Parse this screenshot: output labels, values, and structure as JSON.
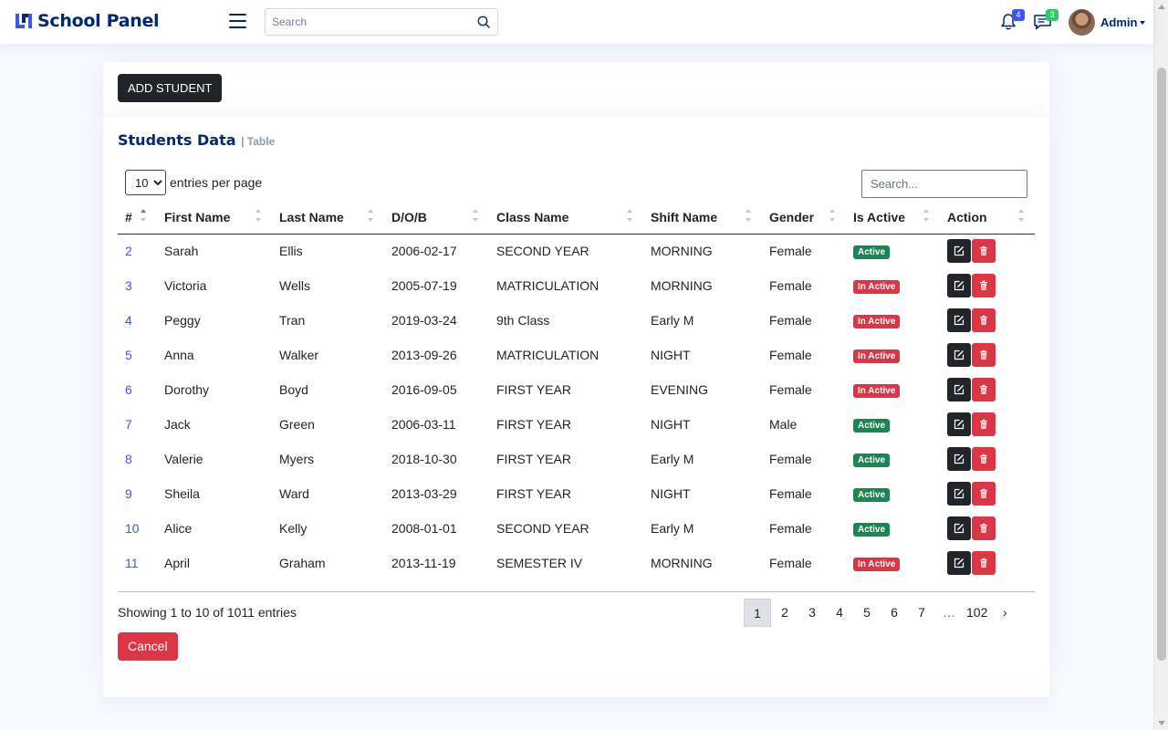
{
  "header": {
    "logo_text": "School Panel",
    "search_placeholder": "Search",
    "notifications_count": "4",
    "messages_count": "3",
    "user_name": "Admin"
  },
  "colors": {
    "brand": "#012970",
    "link": "#4154f1",
    "active": "#198754",
    "inactive": "#dc3545",
    "dark_button": "#212529"
  },
  "page": {
    "add_button": "ADD STUDENT",
    "title": "Students Data",
    "subtitle": "| Table",
    "per_page_value": "10",
    "per_page_label": "entries per page",
    "table_search_placeholder": "Search...",
    "showing_text": "Showing 1 to 10 of 1011 entries",
    "cancel_button": "Cancel"
  },
  "table": {
    "columns": [
      "#",
      "First Name",
      "Last Name",
      "D/O/B",
      "Class Name",
      "Shift Name",
      "Gender",
      "Is Active",
      "Action"
    ],
    "rows": [
      {
        "id": "2",
        "first": "Sarah",
        "last": "Ellis",
        "dob": "2006-02-17",
        "class": "SECOND YEAR",
        "shift": "MORNING",
        "gender": "Female",
        "status": "Active"
      },
      {
        "id": "3",
        "first": "Victoria",
        "last": "Wells",
        "dob": "2005-07-19",
        "class": "MATRICULATION",
        "shift": "MORNING",
        "gender": "Female",
        "status": "In Active"
      },
      {
        "id": "4",
        "first": "Peggy",
        "last": "Tran",
        "dob": "2019-03-24",
        "class": "9th Class",
        "shift": "Early M",
        "gender": "Female",
        "status": "In Active"
      },
      {
        "id": "5",
        "first": "Anna",
        "last": "Walker",
        "dob": "2013-09-26",
        "class": "MATRICULATION",
        "shift": "NIGHT",
        "gender": "Female",
        "status": "In Active"
      },
      {
        "id": "6",
        "first": "Dorothy",
        "last": "Boyd",
        "dob": "2016-09-05",
        "class": "FIRST YEAR",
        "shift": "EVENING",
        "gender": "Female",
        "status": "In Active"
      },
      {
        "id": "7",
        "first": "Jack",
        "last": "Green",
        "dob": "2006-03-11",
        "class": "FIRST YEAR",
        "shift": "NIGHT",
        "gender": "Male",
        "status": "Active"
      },
      {
        "id": "8",
        "first": "Valerie",
        "last": "Myers",
        "dob": "2018-10-30",
        "class": "FIRST YEAR",
        "shift": "Early M",
        "gender": "Female",
        "status": "Active"
      },
      {
        "id": "9",
        "first": "Sheila",
        "last": "Ward",
        "dob": "2013-03-29",
        "class": "FIRST YEAR",
        "shift": "NIGHT",
        "gender": "Female",
        "status": "Active"
      },
      {
        "id": "10",
        "first": "Alice",
        "last": "Kelly",
        "dob": "2008-01-01",
        "class": "SECOND YEAR",
        "shift": "Early M",
        "gender": "Female",
        "status": "Active"
      },
      {
        "id": "11",
        "first": "April",
        "last": "Graham",
        "dob": "2013-11-19",
        "class": "SEMESTER IV",
        "shift": "MORNING",
        "gender": "Female",
        "status": "In Active"
      }
    ]
  },
  "pagination": {
    "pages": [
      "1",
      "2",
      "3",
      "4",
      "5",
      "6",
      "7",
      "…",
      "102",
      "›"
    ],
    "current": "1"
  },
  "icons": {
    "logo": "logo-icon",
    "menu": "hamburger-icon",
    "search": "search-icon",
    "notifications": "bell-icon",
    "messages": "chat-icon",
    "edit": "edit-icon",
    "delete": "trash-icon"
  }
}
